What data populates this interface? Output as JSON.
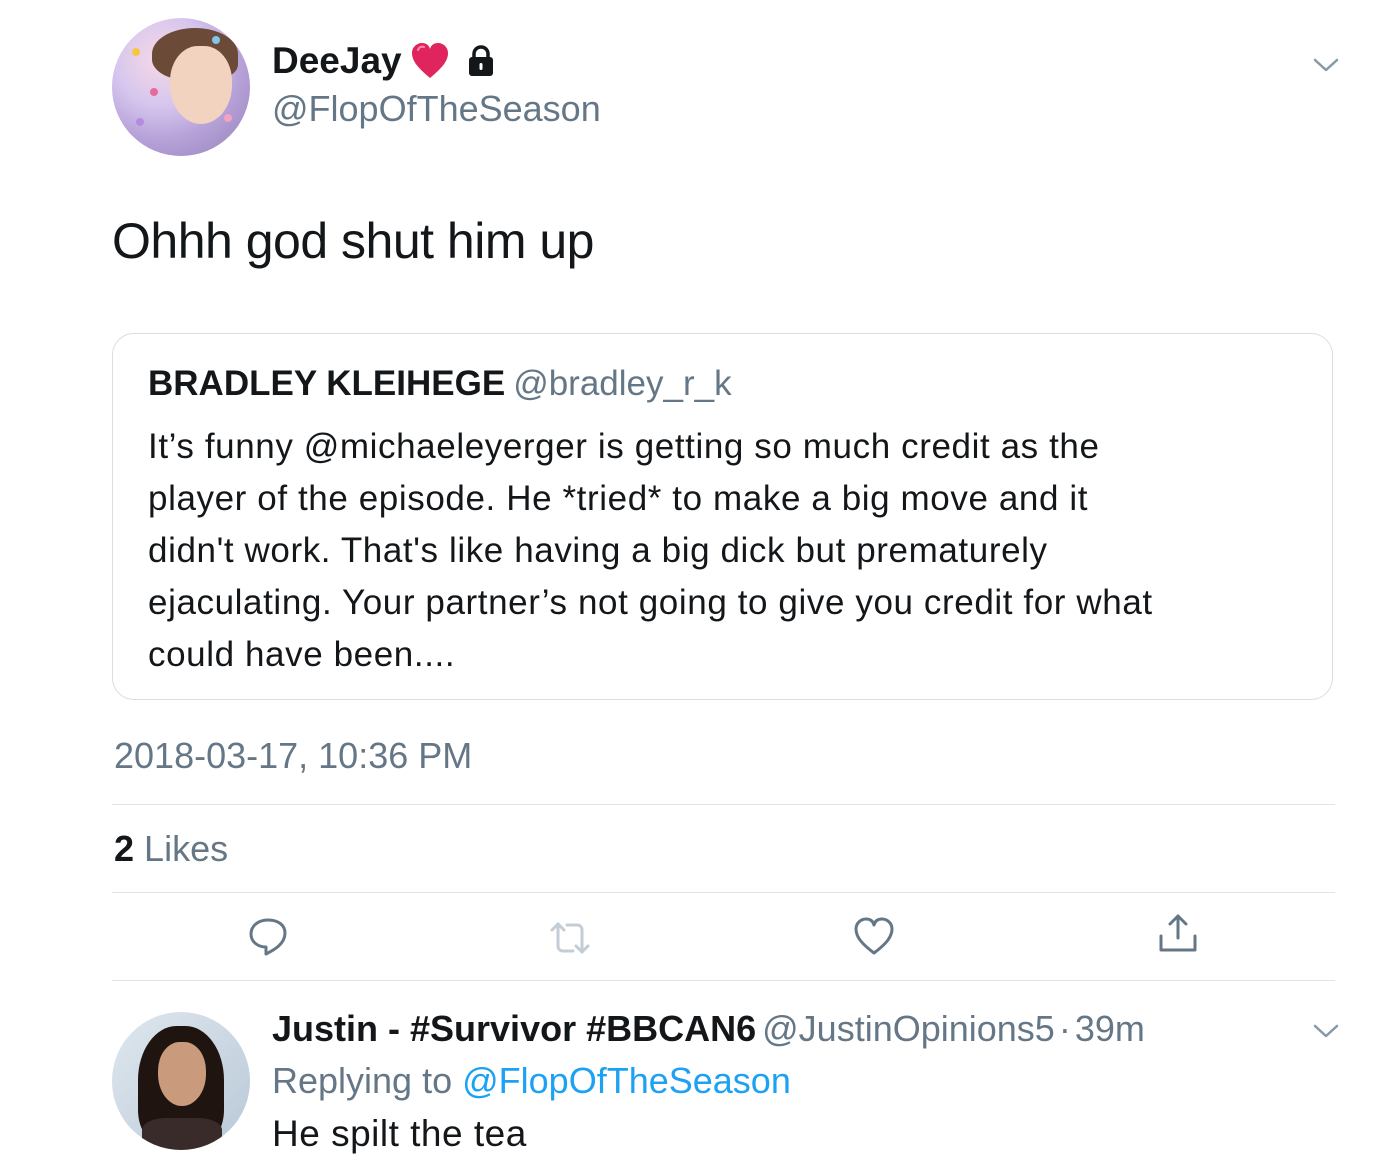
{
  "tweet": {
    "author": {
      "display_name": "DeeJay",
      "handle": "@FlopOfTheSeason",
      "badge_emoji": "red-heart-icon",
      "protected_icon": "lock-icon"
    },
    "text": "Ohhh god shut him up",
    "quoted": {
      "author_name": "BRADLEY KLEIHEGE",
      "author_handle": "@bradley_r_k",
      "lines": [
        "It’s funny @michaeleyerger is getting so much credit as the",
        "player of the episode. He *tried* to make a big move and it",
        "didn't work. That's like having a big dick but prematurely",
        "ejaculating. Your partner’s not going to give you credit for what",
        "could have been...."
      ]
    },
    "timestamp": "2018-03-17, 10:36 PM",
    "likes": {
      "count": "2",
      "label": "Likes"
    },
    "actions": [
      "reply-icon",
      "retweet-icon",
      "like-icon",
      "share-icon"
    ]
  },
  "reply": {
    "display_name": "Justin - #Survivor  #BBCAN6",
    "handle": "@JustinOpinions5",
    "separator": "·",
    "time": "39m",
    "replying_prefix": "Replying to",
    "replying_target": "@FlopOfTheSeason",
    "text": "He spilt the tea"
  },
  "colors": {
    "text_primary": "#14171a",
    "text_secondary": "#657786",
    "link": "#1da1f2",
    "divider": "#dfe4e8",
    "heart": "#e0245e"
  }
}
